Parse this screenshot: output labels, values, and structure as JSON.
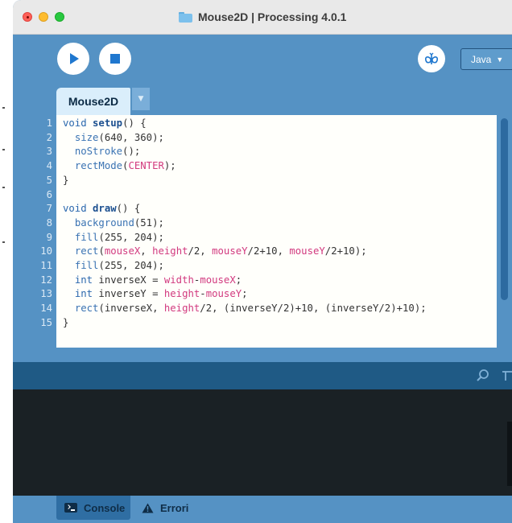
{
  "window": {
    "title": "Mouse2D | Processing 4.0.1"
  },
  "toolbar": {
    "run_icon": "play-icon",
    "stop_icon": "stop-icon",
    "debug_icon": "butterfly-debug-icon",
    "mode_label": "Java",
    "mode_caret": "▼"
  },
  "tabs": {
    "active_label": "Mouse2D",
    "menu_glyph": "▼"
  },
  "editor": {
    "lines": [
      {
        "num": "1",
        "parts": [
          {
            "t": "void ",
            "c": "kw"
          },
          {
            "t": "setup",
            "c": "fn"
          },
          {
            "t": "() {",
            "c": ""
          }
        ]
      },
      {
        "num": "2",
        "parts": [
          {
            "t": "  ",
            "c": ""
          },
          {
            "t": "size",
            "c": "bi"
          },
          {
            "t": "(640, 360);",
            "c": ""
          }
        ]
      },
      {
        "num": "3",
        "parts": [
          {
            "t": "  ",
            "c": ""
          },
          {
            "t": "noStroke",
            "c": "bi"
          },
          {
            "t": "();",
            "c": ""
          }
        ]
      },
      {
        "num": "4",
        "parts": [
          {
            "t": "  ",
            "c": ""
          },
          {
            "t": "rectMode",
            "c": "bi"
          },
          {
            "t": "(",
            "c": ""
          },
          {
            "t": "CENTER",
            "c": "pink"
          },
          {
            "t": ");",
            "c": ""
          }
        ]
      },
      {
        "num": "5",
        "parts": [
          {
            "t": "}",
            "c": ""
          }
        ]
      },
      {
        "num": "6",
        "parts": []
      },
      {
        "num": "7",
        "parts": [
          {
            "t": "void ",
            "c": "kw"
          },
          {
            "t": "draw",
            "c": "fn"
          },
          {
            "t": "() {",
            "c": ""
          }
        ]
      },
      {
        "num": "8",
        "parts": [
          {
            "t": "  ",
            "c": ""
          },
          {
            "t": "background",
            "c": "bi"
          },
          {
            "t": "(51);",
            "c": ""
          }
        ]
      },
      {
        "num": "9",
        "parts": [
          {
            "t": "  ",
            "c": ""
          },
          {
            "t": "fill",
            "c": "bi"
          },
          {
            "t": "(255, 204);",
            "c": ""
          }
        ]
      },
      {
        "num": "10",
        "parts": [
          {
            "t": "  ",
            "c": ""
          },
          {
            "t": "rect",
            "c": "bi"
          },
          {
            "t": "(",
            "c": ""
          },
          {
            "t": "mouseX",
            "c": "pink"
          },
          {
            "t": ", ",
            "c": ""
          },
          {
            "t": "height",
            "c": "pink"
          },
          {
            "t": "/2, ",
            "c": ""
          },
          {
            "t": "mouseY",
            "c": "pink"
          },
          {
            "t": "/2+10, ",
            "c": ""
          },
          {
            "t": "mouseY",
            "c": "pink"
          },
          {
            "t": "/2+10);",
            "c": ""
          }
        ]
      },
      {
        "num": "11",
        "parts": [
          {
            "t": "  ",
            "c": ""
          },
          {
            "t": "fill",
            "c": "bi"
          },
          {
            "t": "(255, 204);",
            "c": ""
          }
        ]
      },
      {
        "num": "12",
        "parts": [
          {
            "t": "  ",
            "c": ""
          },
          {
            "t": "int",
            "c": "kw"
          },
          {
            "t": " inverseX = ",
            "c": ""
          },
          {
            "t": "width",
            "c": "pink"
          },
          {
            "t": "-",
            "c": ""
          },
          {
            "t": "mouseX",
            "c": "pink"
          },
          {
            "t": ";",
            "c": ""
          }
        ]
      },
      {
        "num": "13",
        "parts": [
          {
            "t": "  ",
            "c": ""
          },
          {
            "t": "int",
            "c": "kw"
          },
          {
            "t": " inverseY = ",
            "c": ""
          },
          {
            "t": "height",
            "c": "pink"
          },
          {
            "t": "-",
            "c": ""
          },
          {
            "t": "mouseY",
            "c": "pink"
          },
          {
            "t": ";",
            "c": ""
          }
        ]
      },
      {
        "num": "14",
        "parts": [
          {
            "t": "  ",
            "c": ""
          },
          {
            "t": "rect",
            "c": "bi"
          },
          {
            "t": "(inverseX, ",
            "c": ""
          },
          {
            "t": "height",
            "c": "pink"
          },
          {
            "t": "/2, (inverseY/2)+10, (inverseY/2)+10);",
            "c": ""
          }
        ]
      },
      {
        "num": "15",
        "parts": [
          {
            "t": "}",
            "c": ""
          }
        ]
      }
    ]
  },
  "console": {
    "search_icon": "search-icon"
  },
  "status_tabs": {
    "console_label": "Console",
    "errors_label": "Errori"
  }
}
